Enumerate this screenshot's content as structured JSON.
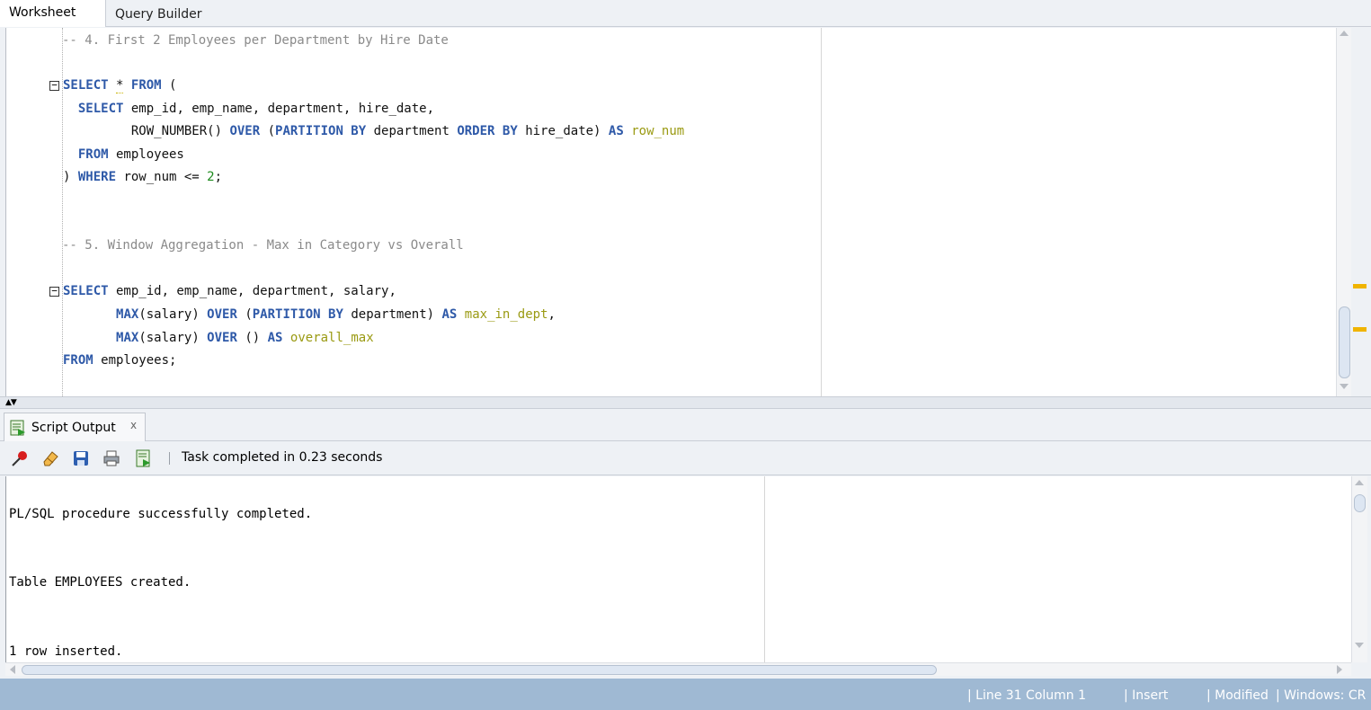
{
  "tabs": {
    "worksheet": "Worksheet",
    "query_builder": "Query Builder"
  },
  "editor": {
    "lines": [
      {
        "parts": [
          {
            "t": "-- 4. First 2 Employees per Department by Hire Date",
            "c": "cm"
          }
        ]
      },
      {
        "parts": [
          {
            "t": "SELECT",
            "c": "kw"
          },
          {
            "t": " "
          },
          {
            "t": "*",
            "c": "sq"
          },
          {
            "t": " "
          },
          {
            "t": "FROM",
            "c": "kw"
          },
          {
            "t": " ("
          }
        ]
      },
      {
        "parts": [
          {
            "t": "  "
          },
          {
            "t": "SELECT",
            "c": "kw"
          },
          {
            "t": " emp_id, emp_name, department, hire_date,"
          }
        ]
      },
      {
        "parts": [
          {
            "t": "         ROW_NUMBER() "
          },
          {
            "t": "OVER",
            "c": "kw"
          },
          {
            "t": " ("
          },
          {
            "t": "PARTITION BY",
            "c": "kw"
          },
          {
            "t": " department "
          },
          {
            "t": "ORDER BY",
            "c": "kw"
          },
          {
            "t": " hire_date) "
          },
          {
            "t": "AS",
            "c": "kw"
          },
          {
            "t": " "
          },
          {
            "t": "row_num",
            "c": "al"
          }
        ]
      },
      {
        "parts": [
          {
            "t": "  "
          },
          {
            "t": "FROM",
            "c": "kw"
          },
          {
            "t": " employees"
          }
        ]
      },
      {
        "parts": [
          {
            "t": ") "
          },
          {
            "t": "WHERE",
            "c": "kw"
          },
          {
            "t": " row_num <= "
          },
          {
            "t": "2",
            "c": "nm"
          },
          {
            "t": ";"
          }
        ]
      },
      {
        "parts": []
      },
      {
        "parts": []
      },
      {
        "parts": [
          {
            "t": "-- 5. Window Aggregation - Max in Category vs Overall",
            "c": "cm"
          }
        ]
      },
      {
        "parts": []
      },
      {
        "parts": [
          {
            "t": "SELECT",
            "c": "kw"
          },
          {
            "t": " emp_id, emp_name, department, salary,"
          }
        ]
      },
      {
        "parts": [
          {
            "t": "       "
          },
          {
            "t": "MAX",
            "c": "fn"
          },
          {
            "t": "(salary) "
          },
          {
            "t": "OVER",
            "c": "kw"
          },
          {
            "t": " ("
          },
          {
            "t": "PARTITION BY",
            "c": "kw"
          },
          {
            "t": " department) "
          },
          {
            "t": "AS",
            "c": "kw"
          },
          {
            "t": " "
          },
          {
            "t": "max_in_dept",
            "c": "al"
          },
          {
            "t": ","
          }
        ]
      },
      {
        "parts": [
          {
            "t": "       "
          },
          {
            "t": "MAX",
            "c": "fn"
          },
          {
            "t": "(salary) "
          },
          {
            "t": "OVER",
            "c": "kw"
          },
          {
            "t": " () "
          },
          {
            "t": "AS",
            "c": "kw"
          },
          {
            "t": " "
          },
          {
            "t": "overall_max",
            "c": "al"
          }
        ]
      },
      {
        "parts": [
          {
            "t": "FROM",
            "c": "kw"
          },
          {
            "t": " employees;"
          }
        ]
      }
    ]
  },
  "output_panel": {
    "tab_label": "Script Output",
    "close_glyph": "x",
    "task_status": "Task completed in 0.23 seconds",
    "lines": [
      "PL/SQL procedure successfully completed.",
      "Table EMPLOYEES created.",
      "1 row inserted."
    ]
  },
  "statusbar": {
    "position": "| Line 31 Column 1",
    "mode": "| Insert",
    "modified": "| Modified",
    "line_endings": "| Windows: CR"
  },
  "colors": {
    "keyword": "#2e59a8",
    "comment": "#8a8a8a",
    "alias": "#9a9a12",
    "number": "#1d8a1d",
    "statusbar": "#9fb9d3",
    "marker": "#f0b400"
  },
  "icons": [
    "pin-icon",
    "eraser-icon",
    "save-icon",
    "print-icon",
    "open-output-icon",
    "script-output-icon"
  ]
}
